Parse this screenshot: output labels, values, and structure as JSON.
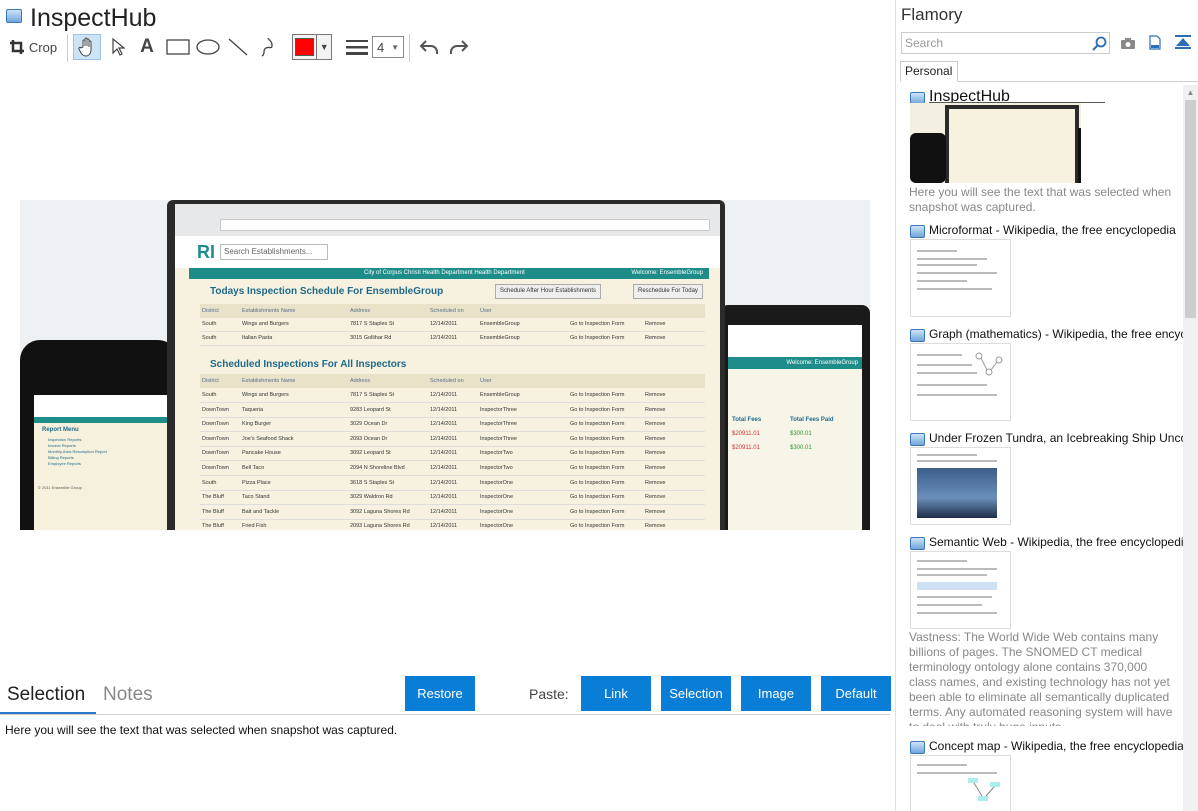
{
  "app": {
    "title": "InspectHub"
  },
  "toolbar": {
    "crop_label": "Crop",
    "line_width_value": "4",
    "color": "#ff0000"
  },
  "snapshot": {
    "logo": "RI",
    "search_placeholder": "Search Establishments...",
    "banner": "City of Corpus Christi Health Department Health Department",
    "welcome": "Welcome: EnsembleGroup",
    "section1_title": "Todays Inspection Schedule For EnsembleGroup",
    "btn_after_hour": "Schedule After Hour Establishments",
    "btn_reschedule": "Reschedule For Today",
    "section2_title": "Scheduled Inspections For All Inspectors",
    "headers": [
      "District",
      "Establishments Name",
      "Address",
      "Scheduled on",
      "User"
    ],
    "go_label": "Go to Inspection Form",
    "remove_label": "Remove",
    "today_rows": [
      [
        "South",
        "Wings and Burgers",
        "7817 S Staples St",
        "12/14/2011",
        "EnsembleGroup"
      ],
      [
        "South",
        "Italian Pasta",
        "3015 Gollihar Rd",
        "12/14/2011",
        "EnsembleGroup"
      ]
    ],
    "all_rows": [
      [
        "South",
        "Wings and Burgers",
        "7817 S Staples St",
        "12/14/2011",
        "EnsembleGroup"
      ],
      [
        "DownTown",
        "Taqueria",
        "9283 Leopard St",
        "12/14/2011",
        "InspectorThree"
      ],
      [
        "DownTown",
        "King Burger",
        "3029 Ocean Dr",
        "12/14/2011",
        "InspectorThree"
      ],
      [
        "DownTown",
        "Joe's Seafood Shack",
        "2093 Ocean Dr",
        "12/14/2011",
        "InspectorThree"
      ],
      [
        "DownTown",
        "Pancake House",
        "3092 Leopard St",
        "12/14/2011",
        "InspectorTwo"
      ],
      [
        "DownTown",
        "Bell Taco",
        "2094 N Shoreline Blvd",
        "12/14/2011",
        "InspectorTwo"
      ],
      [
        "South",
        "Pizza Place",
        "3618 S Staples St",
        "12/14/2011",
        "InspectorOne"
      ],
      [
        "The Bluff",
        "Taco Stand",
        "3029 Waldron Rd",
        "12/14/2011",
        "InspectorOne"
      ],
      [
        "The Bluff",
        "Bait and Tackle",
        "3092 Laguna Shores Rd",
        "12/14/2011",
        "InspectorOne"
      ],
      [
        "The Bluff",
        "Fried Fish",
        "2093 Laguna Shores Rd",
        "12/14/2011",
        "InspectorOne"
      ]
    ],
    "phone_menu_title": "Report Menu",
    "phone_menu_items": [
      "Inspection Reports",
      "Invoice Reports",
      "Monthly Area Resumption Report",
      "Billing Reports",
      "Employee Reports"
    ],
    "phone_footer": "© 2011 Ensemble Group",
    "tablet_welcome": "Welcome: EnsembleGroup",
    "tablet_col1": "Total Fees",
    "tablet_col2": "Total Fees Paid",
    "tablet_rows": [
      [
        "$20911.01",
        "$300.01"
      ],
      [
        "$20911.01",
        "$300.01"
      ]
    ]
  },
  "bottom": {
    "tab_selection": "Selection",
    "tab_notes": "Notes",
    "restore_label": "Restore",
    "paste_label": "Paste:",
    "paste_link": "Link",
    "paste_selection": "Selection",
    "paste_image": "Image",
    "paste_default": "Default",
    "selection_text": "Here you will see the text that was selected when snapshot was captured."
  },
  "sidebar": {
    "title": "Flamory",
    "search_placeholder": "Search",
    "tab_personal": "Personal",
    "items": [
      {
        "title": "InspectHub",
        "desc": "Here you will see the text that was selected when snapshot was captured."
      },
      {
        "title": "Microformat - Wikipedia, the free encyclopedia",
        "desc": ""
      },
      {
        "title": "Graph (mathematics) - Wikipedia, the free encyclopedia",
        "desc": ""
      },
      {
        "title": "Under Frozen Tundra, an Icebreaking Ship Uncovers",
        "desc": ""
      },
      {
        "title": "Semantic Web - Wikipedia, the free encyclopedia",
        "desc": "Vastness: The World Wide Web contains many billions of pages. The SNOMED CT medical terminology ontology alone contains 370,000 class names, and existing technology has not yet been able to eliminate all semantically duplicated terms. Any automated reasoning system will have to deal with truly huge inputs."
      },
      {
        "title": "Concept map - Wikipedia, the free encyclopedia",
        "desc": ""
      }
    ]
  }
}
